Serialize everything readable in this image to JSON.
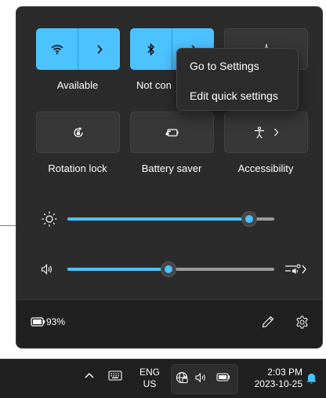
{
  "tiles": {
    "wifi": {
      "label": "Available"
    },
    "bluetooth": {
      "label": "Not con"
    },
    "rotation": {
      "label": "Rotation lock"
    },
    "battery_saver": {
      "label": "Battery saver"
    },
    "accessibility": {
      "label": "Accessibility"
    }
  },
  "sliders": {
    "brightness": {
      "value_fraction": 0.88
    },
    "volume": {
      "value_fraction": 0.49
    }
  },
  "context_menu": {
    "items": [
      "Go to Settings",
      "Edit quick settings"
    ]
  },
  "footer": {
    "battery_percent": "93%"
  },
  "taskbar": {
    "language_line1": "ENG",
    "language_line2": "US",
    "time": "2:03 PM",
    "date": "2023-10-25"
  },
  "colors": {
    "accent": "#4cc2ff",
    "panel": "#2b2b2b",
    "taskbar": "#202020",
    "notification": "#4cc2ff"
  },
  "icons": [
    "wifi-icon",
    "chevron-right-icon",
    "bluetooth-icon",
    "flight-mode-icon",
    "rotation-lock-icon",
    "battery-saver-icon",
    "accessibility-icon",
    "brightness-icon",
    "volume-icon",
    "audio-output-icon",
    "battery-icon",
    "edit-icon",
    "settings-icon",
    "chevron-up-icon",
    "keyboard-icon",
    "network-icon",
    "bell-icon"
  ]
}
